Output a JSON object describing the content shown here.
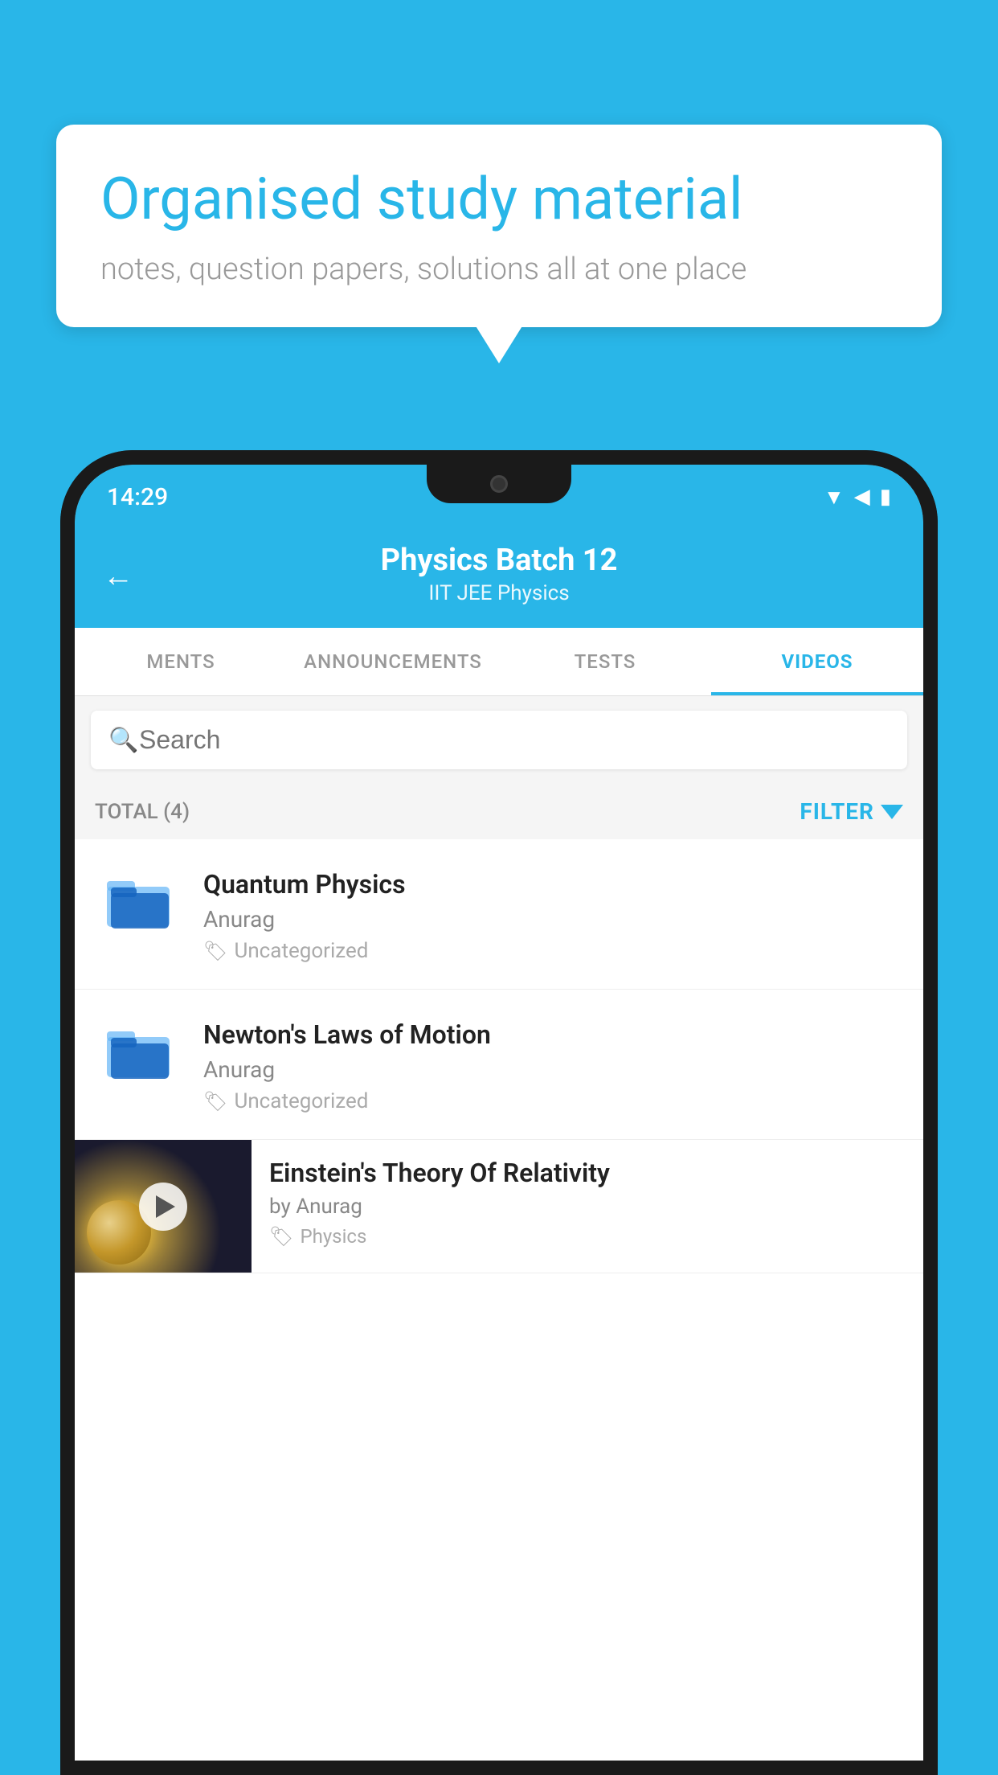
{
  "background": {
    "color": "#29b6e8"
  },
  "speech_bubble": {
    "title": "Organised study material",
    "subtitle": "notes, question papers, solutions all at one place"
  },
  "phone": {
    "status_bar": {
      "time": "14:29",
      "icons": [
        "wifi",
        "signal",
        "battery"
      ]
    },
    "header": {
      "title": "Physics Batch 12",
      "subtitle": "IIT JEE   Physics",
      "back_label": "←"
    },
    "tabs": [
      {
        "label": "MENTS",
        "active": false
      },
      {
        "label": "ANNOUNCEMENTS",
        "active": false
      },
      {
        "label": "TESTS",
        "active": false
      },
      {
        "label": "VIDEOS",
        "active": true
      }
    ],
    "search": {
      "placeholder": "Search"
    },
    "filter_bar": {
      "total_label": "TOTAL (4)",
      "filter_label": "FILTER"
    },
    "videos": [
      {
        "id": 1,
        "title": "Quantum Physics",
        "author": "Anurag",
        "tag": "Uncategorized",
        "type": "folder"
      },
      {
        "id": 2,
        "title": "Newton's Laws of Motion",
        "author": "Anurag",
        "tag": "Uncategorized",
        "type": "folder"
      },
      {
        "id": 3,
        "title": "Einstein's Theory Of Relativity",
        "author": "by Anurag",
        "tag": "Physics",
        "type": "video"
      }
    ]
  }
}
